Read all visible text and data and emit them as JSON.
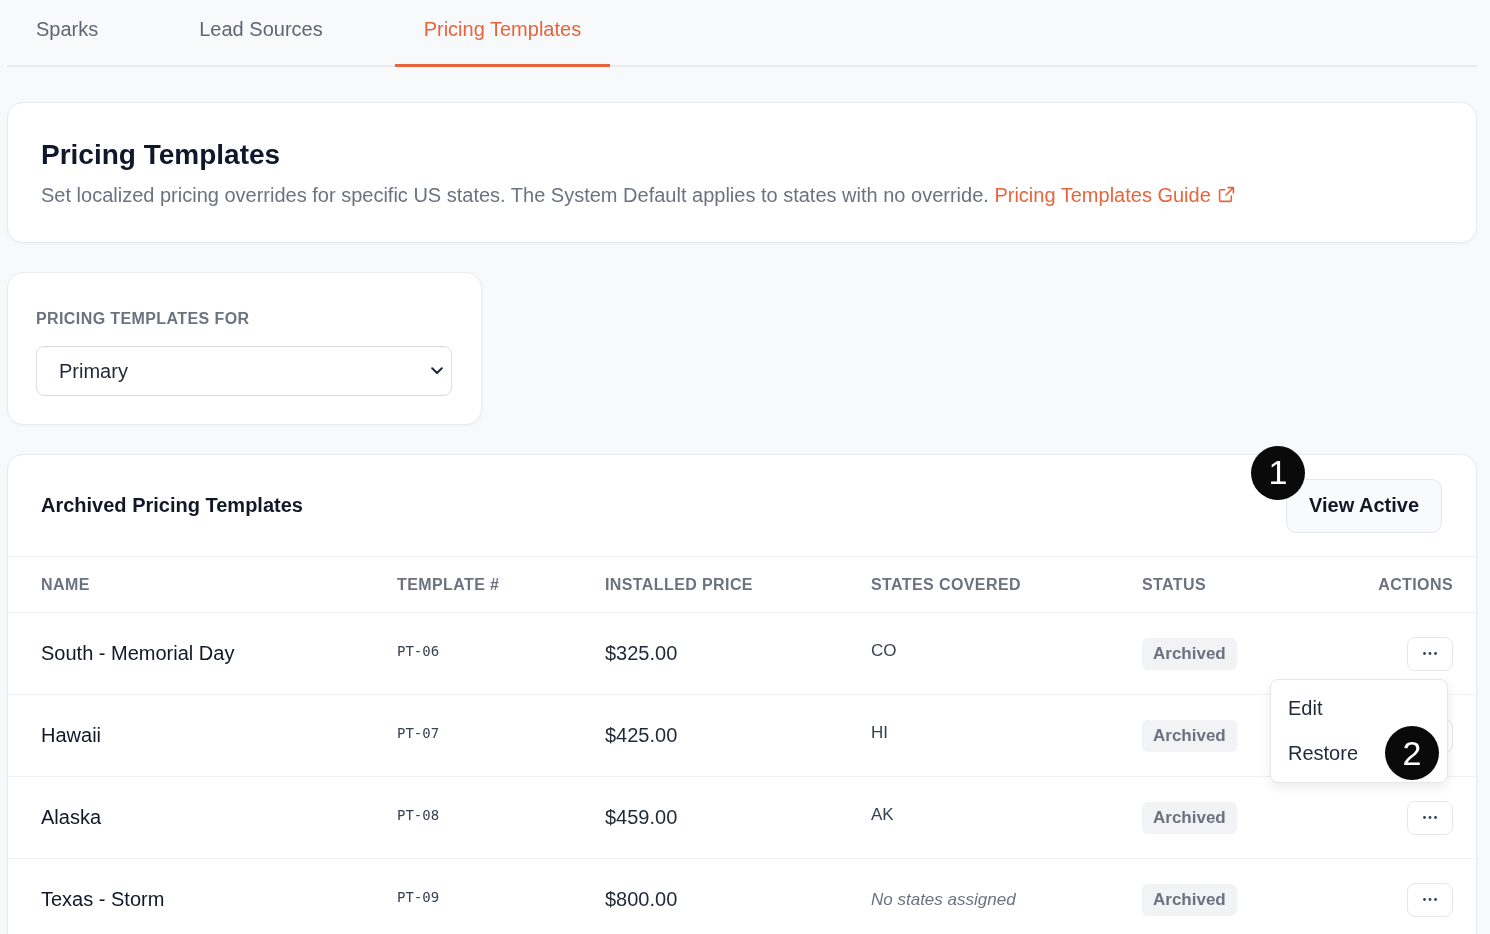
{
  "tabs": [
    {
      "label": "Sparks",
      "selected": false
    },
    {
      "label": "Lead Sources",
      "selected": false
    },
    {
      "label": "Pricing Templates",
      "selected": true
    }
  ],
  "header": {
    "title": "Pricing Templates",
    "description": "Set localized pricing overrides for specific US states. The System Default applies to states with no override.",
    "link": "Pricing Templates Guide"
  },
  "filter": {
    "label": "PRICING TEMPLATES FOR",
    "value": "Primary"
  },
  "table": {
    "title": "Archived Pricing Templates",
    "button": {
      "label": "View Active",
      "callout": "1"
    },
    "columns": [
      "NAME",
      "TEMPLATE #",
      "INSTALLED PRICE",
      "STATES COVERED",
      "STATUS",
      "ACTIONS"
    ],
    "rows": [
      {
        "name": "South - Memorial Day",
        "template": "PT-06",
        "price": "$325.00",
        "states": "CO",
        "states_assigned": true,
        "status": "Archived",
        "menu": [
          {
            "label": "Edit"
          },
          {
            "label": "Restore",
            "callout": "2"
          }
        ]
      },
      {
        "name": "Hawaii",
        "template": "PT-07",
        "price": "$425.00",
        "states": "HI",
        "states_assigned": true,
        "status": "Archived"
      },
      {
        "name": "Alaska",
        "template": "PT-08",
        "price": "$459.00",
        "states": "AK",
        "states_assigned": true,
        "status": "Archived"
      },
      {
        "name": "Texas - Storm",
        "template": "PT-09",
        "price": "$800.00",
        "states": "No states assigned",
        "states_assigned": false,
        "status": "Archived"
      }
    ]
  }
}
